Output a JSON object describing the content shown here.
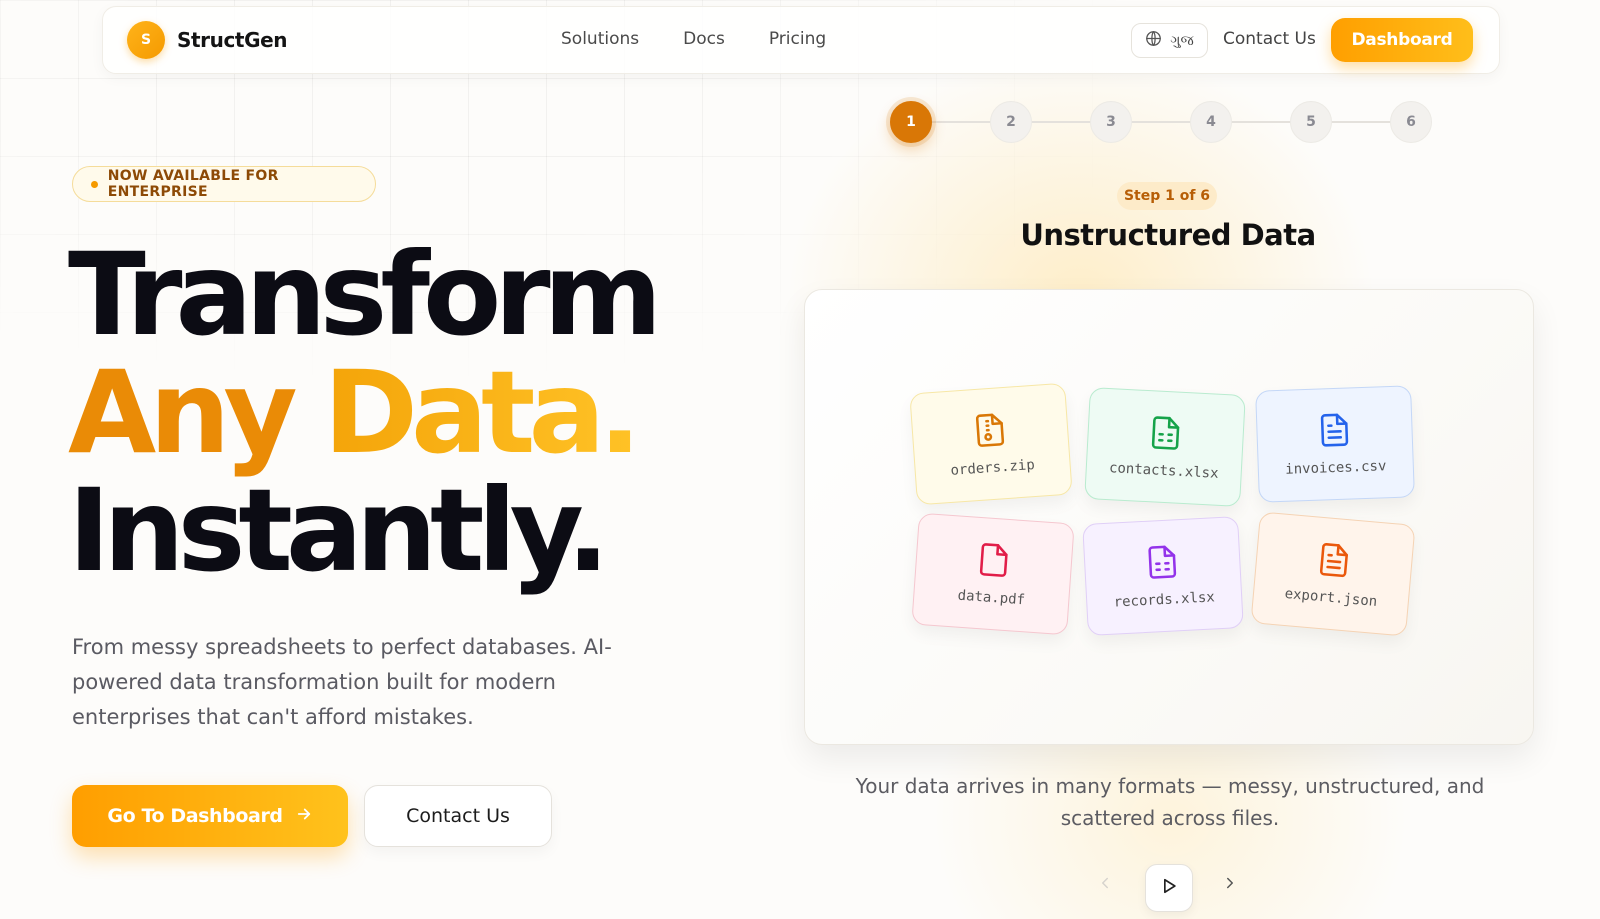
{
  "nav": {
    "brand_initial": "S",
    "brand_name": "StructGen",
    "links": [
      {
        "label": "Solutions"
      },
      {
        "label": "Docs"
      },
      {
        "label": "Pricing"
      }
    ],
    "language_label": "ગુજ",
    "contact_label": "Contact Us",
    "dashboard_label": "Dashboard"
  },
  "hero": {
    "badge": "NOW AVAILABLE FOR ENTERPRISE",
    "title_line_1": "Transform",
    "title_line_2a": "Any",
    "title_line_2b": "Data.",
    "title_line_3": "Instantly.",
    "description": "From messy spreadsheets to perfect databases. AI-powered data transformation built for modern enterprises that can't afford mistakes.",
    "primary_cta": "Go To Dashboard",
    "secondary_cta": "Contact Us"
  },
  "stepper": {
    "steps": [
      "1",
      "2",
      "3",
      "4",
      "5",
      "6"
    ],
    "active_index": 0,
    "step_label": "Step 1 of 6",
    "title": "Unstructured Data",
    "caption": "Your data arrives in many formats — messy, unstructured, and scattered across files."
  },
  "files": [
    {
      "name": "orders.zip",
      "icon": "file-zip-icon",
      "color": "#d97706"
    },
    {
      "name": "contacts.xlsx",
      "icon": "file-spreadsheet-icon",
      "color": "#16a34a"
    },
    {
      "name": "invoices.csv",
      "icon": "file-text-icon",
      "color": "#2563eb"
    },
    {
      "name": "data.pdf",
      "icon": "file-icon",
      "color": "#e11d48"
    },
    {
      "name": "records.xlsx",
      "icon": "file-spreadsheet-icon",
      "color": "#9333ea"
    },
    {
      "name": "export.json",
      "icon": "file-text-icon",
      "color": "#ea580c"
    }
  ],
  "colors": {
    "accent": "#ffa500",
    "accent_dark": "#d97706",
    "text_dark": "#0c0c14"
  }
}
